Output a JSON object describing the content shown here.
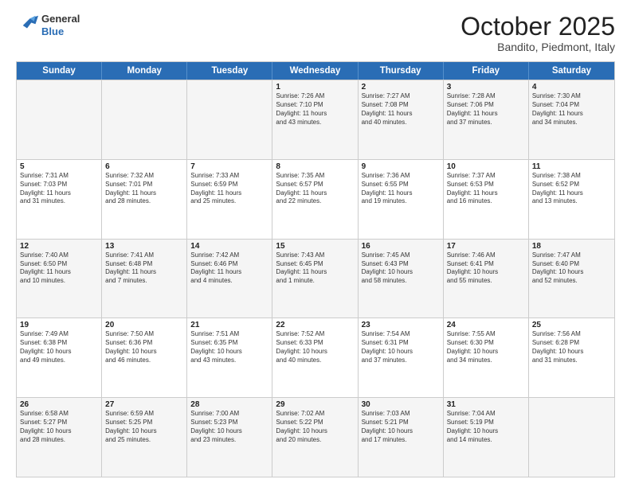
{
  "header": {
    "logo": {
      "general": "General",
      "blue": "Blue"
    },
    "title": "October 2025",
    "subtitle": "Bandito, Piedmont, Italy"
  },
  "weekdays": [
    "Sunday",
    "Monday",
    "Tuesday",
    "Wednesday",
    "Thursday",
    "Friday",
    "Saturday"
  ],
  "rows": [
    [
      {
        "day": "",
        "info": ""
      },
      {
        "day": "",
        "info": ""
      },
      {
        "day": "",
        "info": ""
      },
      {
        "day": "1",
        "info": "Sunrise: 7:26 AM\nSunset: 7:10 PM\nDaylight: 11 hours\nand 43 minutes."
      },
      {
        "day": "2",
        "info": "Sunrise: 7:27 AM\nSunset: 7:08 PM\nDaylight: 11 hours\nand 40 minutes."
      },
      {
        "day": "3",
        "info": "Sunrise: 7:28 AM\nSunset: 7:06 PM\nDaylight: 11 hours\nand 37 minutes."
      },
      {
        "day": "4",
        "info": "Sunrise: 7:30 AM\nSunset: 7:04 PM\nDaylight: 11 hours\nand 34 minutes."
      }
    ],
    [
      {
        "day": "5",
        "info": "Sunrise: 7:31 AM\nSunset: 7:03 PM\nDaylight: 11 hours\nand 31 minutes."
      },
      {
        "day": "6",
        "info": "Sunrise: 7:32 AM\nSunset: 7:01 PM\nDaylight: 11 hours\nand 28 minutes."
      },
      {
        "day": "7",
        "info": "Sunrise: 7:33 AM\nSunset: 6:59 PM\nDaylight: 11 hours\nand 25 minutes."
      },
      {
        "day": "8",
        "info": "Sunrise: 7:35 AM\nSunset: 6:57 PM\nDaylight: 11 hours\nand 22 minutes."
      },
      {
        "day": "9",
        "info": "Sunrise: 7:36 AM\nSunset: 6:55 PM\nDaylight: 11 hours\nand 19 minutes."
      },
      {
        "day": "10",
        "info": "Sunrise: 7:37 AM\nSunset: 6:53 PM\nDaylight: 11 hours\nand 16 minutes."
      },
      {
        "day": "11",
        "info": "Sunrise: 7:38 AM\nSunset: 6:52 PM\nDaylight: 11 hours\nand 13 minutes."
      }
    ],
    [
      {
        "day": "12",
        "info": "Sunrise: 7:40 AM\nSunset: 6:50 PM\nDaylight: 11 hours\nand 10 minutes."
      },
      {
        "day": "13",
        "info": "Sunrise: 7:41 AM\nSunset: 6:48 PM\nDaylight: 11 hours\nand 7 minutes."
      },
      {
        "day": "14",
        "info": "Sunrise: 7:42 AM\nSunset: 6:46 PM\nDaylight: 11 hours\nand 4 minutes."
      },
      {
        "day": "15",
        "info": "Sunrise: 7:43 AM\nSunset: 6:45 PM\nDaylight: 11 hours\nand 1 minute."
      },
      {
        "day": "16",
        "info": "Sunrise: 7:45 AM\nSunset: 6:43 PM\nDaylight: 10 hours\nand 58 minutes."
      },
      {
        "day": "17",
        "info": "Sunrise: 7:46 AM\nSunset: 6:41 PM\nDaylight: 10 hours\nand 55 minutes."
      },
      {
        "day": "18",
        "info": "Sunrise: 7:47 AM\nSunset: 6:40 PM\nDaylight: 10 hours\nand 52 minutes."
      }
    ],
    [
      {
        "day": "19",
        "info": "Sunrise: 7:49 AM\nSunset: 6:38 PM\nDaylight: 10 hours\nand 49 minutes."
      },
      {
        "day": "20",
        "info": "Sunrise: 7:50 AM\nSunset: 6:36 PM\nDaylight: 10 hours\nand 46 minutes."
      },
      {
        "day": "21",
        "info": "Sunrise: 7:51 AM\nSunset: 6:35 PM\nDaylight: 10 hours\nand 43 minutes."
      },
      {
        "day": "22",
        "info": "Sunrise: 7:52 AM\nSunset: 6:33 PM\nDaylight: 10 hours\nand 40 minutes."
      },
      {
        "day": "23",
        "info": "Sunrise: 7:54 AM\nSunset: 6:31 PM\nDaylight: 10 hours\nand 37 minutes."
      },
      {
        "day": "24",
        "info": "Sunrise: 7:55 AM\nSunset: 6:30 PM\nDaylight: 10 hours\nand 34 minutes."
      },
      {
        "day": "25",
        "info": "Sunrise: 7:56 AM\nSunset: 6:28 PM\nDaylight: 10 hours\nand 31 minutes."
      }
    ],
    [
      {
        "day": "26",
        "info": "Sunrise: 6:58 AM\nSunset: 5:27 PM\nDaylight: 10 hours\nand 28 minutes."
      },
      {
        "day": "27",
        "info": "Sunrise: 6:59 AM\nSunset: 5:25 PM\nDaylight: 10 hours\nand 25 minutes."
      },
      {
        "day": "28",
        "info": "Sunrise: 7:00 AM\nSunset: 5:23 PM\nDaylight: 10 hours\nand 23 minutes."
      },
      {
        "day": "29",
        "info": "Sunrise: 7:02 AM\nSunset: 5:22 PM\nDaylight: 10 hours\nand 20 minutes."
      },
      {
        "day": "30",
        "info": "Sunrise: 7:03 AM\nSunset: 5:21 PM\nDaylight: 10 hours\nand 17 minutes."
      },
      {
        "day": "31",
        "info": "Sunrise: 7:04 AM\nSunset: 5:19 PM\nDaylight: 10 hours\nand 14 minutes."
      },
      {
        "day": "",
        "info": ""
      }
    ]
  ],
  "alt_rows": [
    0,
    2,
    4
  ]
}
